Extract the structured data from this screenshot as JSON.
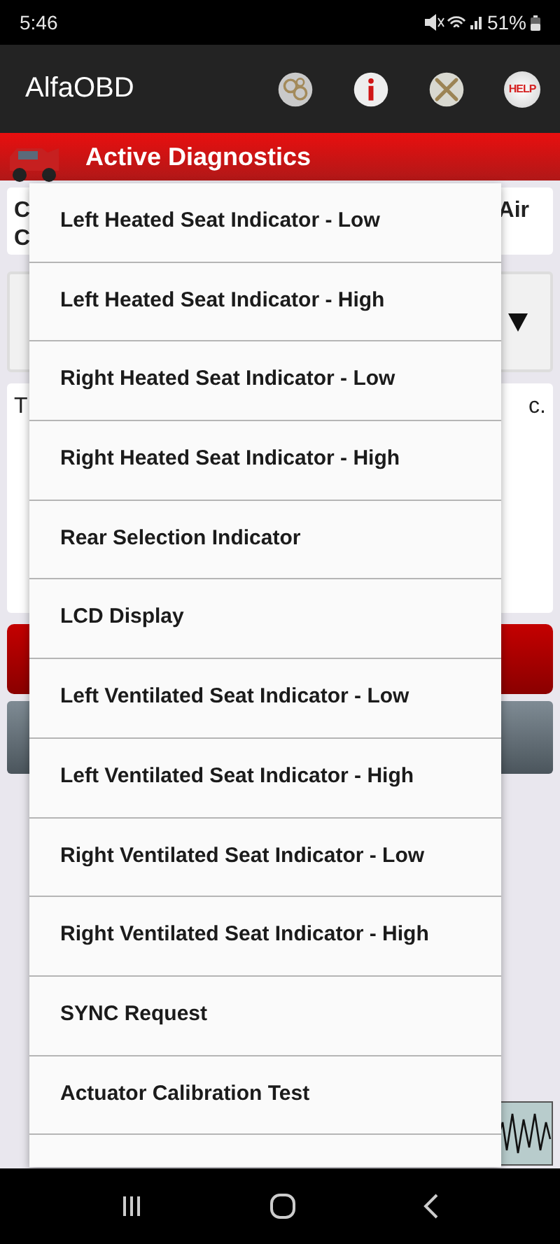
{
  "status_bar": {
    "time": "5:46",
    "battery": "51%"
  },
  "app_bar": {
    "title": "AlfaOBD",
    "help_button": "HELP"
  },
  "header": {
    "title": "Active Diagnostics"
  },
  "background": {
    "module_card": {
      "line_1_start": "C",
      "line_1_end": "Air",
      "line_2_start": "C"
    },
    "description_card": {
      "start": "T",
      "end": "c."
    }
  },
  "menu": {
    "items": [
      {
        "label": "Left Heated Seat Indicator - Low"
      },
      {
        "label": "Left Heated Seat Indicator - High"
      },
      {
        "label": "Right Heated Seat Indicator - Low"
      },
      {
        "label": "Right Heated Seat Indicator - High"
      },
      {
        "label": "Rear Selection Indicator"
      },
      {
        "label": "LCD Display"
      },
      {
        "label": "Left Ventilated Seat Indicator - Low"
      },
      {
        "label": "Left Ventilated Seat Indicator - High"
      },
      {
        "label": "Right Ventilated Seat Indicator - Low"
      },
      {
        "label": "Right Ventilated Seat Indicator - High"
      },
      {
        "label": "SYNC Request"
      },
      {
        "label": "Actuator Calibration Test"
      }
    ]
  }
}
